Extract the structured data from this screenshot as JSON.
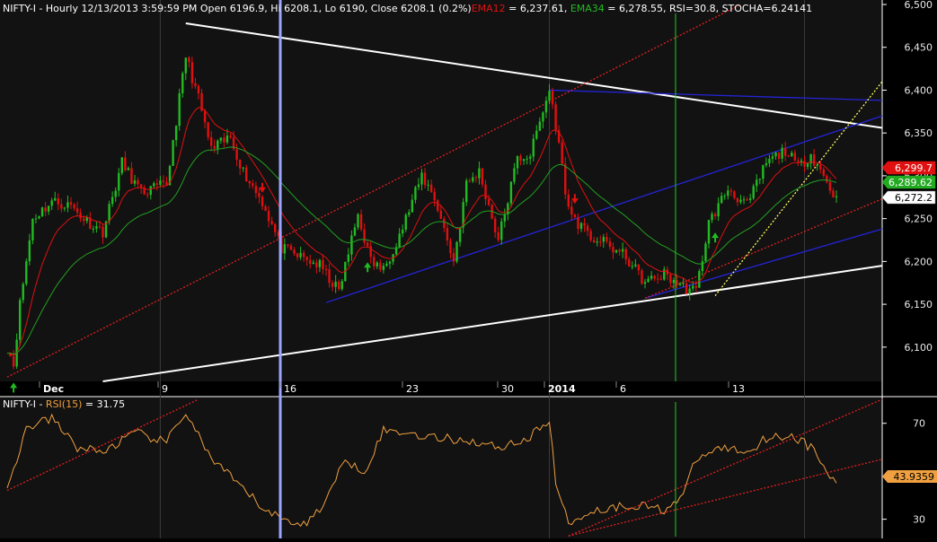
{
  "header": {
    "symbol_info": "NIFTY-I - Hourly 12/13/2013 3:59:59 PM Open 6196.9, Hi 6208.1, Lo 6190, Close 6208.1 (0.2%)",
    "ema12_label": "EMA12",
    "ema12_value": " = 6,237.61, ",
    "ema34_label": "EMA34",
    "ema34_value": " = 6,278.55, RSI=30.8, STOCHA=6.24141"
  },
  "rsi_header": {
    "symbol": "NIFTY-I - ",
    "label": "RSI(15)",
    "value": " = 31.75"
  },
  "colors": {
    "background": "#000000",
    "price_panel_bg": "#121212",
    "bull_candle": "#22bb22",
    "bear_candle": "#e01010",
    "ema12": "#e01010",
    "ema34": "#22a022",
    "rsi_line": "#f0a040",
    "trend_white": "#ffffff",
    "trend_blue": "#2424d8",
    "trend_red_dotted": "#e02020",
    "trend_yellow_dotted": "#ffff60",
    "cursor_line": "#9da6ff",
    "marker_line": "#22cc22",
    "grid": "#2a2a2a"
  },
  "price_axis": {
    "labels": [
      "6,500",
      "6,450",
      "6,400",
      "6,350",
      "6,300",
      "6,250",
      "6,200",
      "6,150",
      "6,100"
    ]
  },
  "rsi_axis": {
    "labels": [
      "70",
      "30"
    ]
  },
  "x_axis": {
    "labels": [
      "Dec",
      "9",
      "16",
      "23",
      "30",
      "2014",
      "6",
      "13"
    ]
  },
  "price_tags": [
    {
      "value": "6,299.7",
      "color": "#e01010",
      "text_color": "#ffffff"
    },
    {
      "value": "6,289.62",
      "color": "#22aa22",
      "text_color": "#ffffff"
    },
    {
      "value": "6,272.2",
      "color": "#ffffff",
      "text_color": "#000000"
    }
  ],
  "rsi_tag": {
    "value": "43.9359",
    "color": "#f0a040",
    "text_color": "#000000"
  },
  "chart_data": {
    "type": "candlestick",
    "timeframe": "Hourly",
    "symbol": "NIFTY-I",
    "ylim": [
      6060,
      6500
    ],
    "rsi_ylim": [
      22,
      80
    ],
    "grid": false,
    "x_dates": [
      "Dec",
      "9",
      "16",
      "23",
      "30",
      "2014",
      "6",
      "13"
    ],
    "close_anchor_points": [
      {
        "bar": 0,
        "close": 6100
      },
      {
        "bar": 2,
        "close": 6080
      },
      {
        "bar": 4,
        "close": 6150
      },
      {
        "bar": 8,
        "close": 6250
      },
      {
        "bar": 14,
        "close": 6270
      },
      {
        "bar": 20,
        "close": 6265
      },
      {
        "bar": 24,
        "close": 6250
      },
      {
        "bar": 30,
        "close": 6235
      },
      {
        "bar": 36,
        "close": 6315
      },
      {
        "bar": 42,
        "close": 6280
      },
      {
        "bar": 50,
        "close": 6290
      },
      {
        "bar": 56,
        "close": 6440
      },
      {
        "bar": 60,
        "close": 6390
      },
      {
        "bar": 64,
        "close": 6330
      },
      {
        "bar": 70,
        "close": 6345
      },
      {
        "bar": 74,
        "close": 6305
      },
      {
        "bar": 80,
        "close": 6270
      },
      {
        "bar": 86,
        "close": 6215
      },
      {
        "bar": 92,
        "close": 6205
      },
      {
        "bar": 98,
        "close": 6195
      },
      {
        "bar": 104,
        "close": 6165
      },
      {
        "bar": 110,
        "close": 6255
      },
      {
        "bar": 114,
        "close": 6200
      },
      {
        "bar": 118,
        "close": 6190
      },
      {
        "bar": 124,
        "close": 6240
      },
      {
        "bar": 130,
        "close": 6300
      },
      {
        "bar": 134,
        "close": 6275
      },
      {
        "bar": 140,
        "close": 6200
      },
      {
        "bar": 144,
        "close": 6290
      },
      {
        "bar": 148,
        "close": 6305
      },
      {
        "bar": 154,
        "close": 6225
      },
      {
        "bar": 160,
        "close": 6320
      },
      {
        "bar": 164,
        "close": 6325
      },
      {
        "bar": 170,
        "close": 6400
      },
      {
        "bar": 172,
        "close": 6360
      },
      {
        "bar": 176,
        "close": 6260
      },
      {
        "bar": 182,
        "close": 6230
      },
      {
        "bar": 188,
        "close": 6220
      },
      {
        "bar": 194,
        "close": 6205
      },
      {
        "bar": 200,
        "close": 6175
      },
      {
        "bar": 206,
        "close": 6185
      },
      {
        "bar": 212,
        "close": 6170
      },
      {
        "bar": 216,
        "close": 6165
      },
      {
        "bar": 220,
        "close": 6245
      },
      {
        "bar": 226,
        "close": 6285
      },
      {
        "bar": 232,
        "close": 6265
      },
      {
        "bar": 238,
        "close": 6315
      },
      {
        "bar": 244,
        "close": 6330
      },
      {
        "bar": 248,
        "close": 6310
      },
      {
        "bar": 252,
        "close": 6325
      },
      {
        "bar": 256,
        "close": 6300
      },
      {
        "bar": 260,
        "close": 6272
      }
    ],
    "rsi_anchor_points": [
      {
        "bar": 0,
        "rsi": 42
      },
      {
        "bar": 6,
        "rsi": 68
      },
      {
        "bar": 14,
        "rsi": 72
      },
      {
        "bar": 22,
        "rsi": 60
      },
      {
        "bar": 30,
        "rsi": 58
      },
      {
        "bar": 40,
        "rsi": 66
      },
      {
        "bar": 50,
        "rsi": 62
      },
      {
        "bar": 56,
        "rsi": 75
      },
      {
        "bar": 64,
        "rsi": 55
      },
      {
        "bar": 72,
        "rsi": 45
      },
      {
        "bar": 80,
        "rsi": 35
      },
      {
        "bar": 86,
        "rsi": 30
      },
      {
        "bar": 94,
        "rsi": 28
      },
      {
        "bar": 100,
        "rsi": 38
      },
      {
        "bar": 106,
        "rsi": 55
      },
      {
        "bar": 112,
        "rsi": 50
      },
      {
        "bar": 118,
        "rsi": 67
      },
      {
        "bar": 126,
        "rsi": 66
      },
      {
        "bar": 134,
        "rsi": 64
      },
      {
        "bar": 144,
        "rsi": 63
      },
      {
        "bar": 154,
        "rsi": 60
      },
      {
        "bar": 164,
        "rsi": 64
      },
      {
        "bar": 170,
        "rsi": 72
      },
      {
        "bar": 172,
        "rsi": 45
      },
      {
        "bar": 176,
        "rsi": 28
      },
      {
        "bar": 182,
        "rsi": 33
      },
      {
        "bar": 190,
        "rsi": 35
      },
      {
        "bar": 198,
        "rsi": 36
      },
      {
        "bar": 206,
        "rsi": 34
      },
      {
        "bar": 212,
        "rsi": 40
      },
      {
        "bar": 216,
        "rsi": 55
      },
      {
        "bar": 224,
        "rsi": 60
      },
      {
        "bar": 232,
        "rsi": 58
      },
      {
        "bar": 238,
        "rsi": 64
      },
      {
        "bar": 246,
        "rsi": 65
      },
      {
        "bar": 252,
        "rsi": 60
      },
      {
        "bar": 256,
        "rsi": 52
      },
      {
        "bar": 260,
        "rsi": 44
      }
    ],
    "trendlines_price": [
      {
        "name": "white-upper",
        "color": "white",
        "style": "solid",
        "from": {
          "bar": 56,
          "price": 6478
        },
        "to": {
          "bar": 275,
          "price": 6356
        }
      },
      {
        "name": "white-lower",
        "color": "white",
        "style": "solid",
        "from": {
          "bar": 30,
          "price": 6060
        },
        "to": {
          "bar": 275,
          "price": 6195
        }
      },
      {
        "name": "blue-upper",
        "color": "blue",
        "style": "solid",
        "from": {
          "bar": 170,
          "price": 6400
        },
        "to": {
          "bar": 275,
          "price": 6388
        }
      },
      {
        "name": "blue-channel",
        "color": "blue",
        "style": "solid",
        "from": {
          "bar": 100,
          "price": 6152
        },
        "to": {
          "bar": 275,
          "price": 6370
        }
      },
      {
        "name": "blue-lower",
        "color": "blue",
        "style": "solid",
        "from": {
          "bar": 200,
          "price": 6157
        },
        "to": {
          "bar": 275,
          "price": 6238
        }
      },
      {
        "name": "red-dotted-main",
        "color": "red",
        "style": "dotted",
        "from": {
          "bar": 0,
          "price": 6065
        },
        "to": {
          "bar": 230,
          "price": 6500
        }
      },
      {
        "name": "red-dotted-lower",
        "color": "red",
        "style": "dotted",
        "from": {
          "bar": 200,
          "price": 6157
        },
        "to": {
          "bar": 275,
          "price": 6273
        }
      },
      {
        "name": "yellow-dotted",
        "color": "yellow",
        "style": "dotted",
        "from": {
          "bar": 222,
          "price": 6160
        },
        "to": {
          "bar": 275,
          "price": 6410
        }
      }
    ],
    "arrows": [
      {
        "bar": 2,
        "direction": "up"
      },
      {
        "bar": 80,
        "direction": "down"
      },
      {
        "bar": 113,
        "direction": "up"
      },
      {
        "bar": 178,
        "direction": "down"
      },
      {
        "bar": 222,
        "direction": "up"
      }
    ]
  }
}
